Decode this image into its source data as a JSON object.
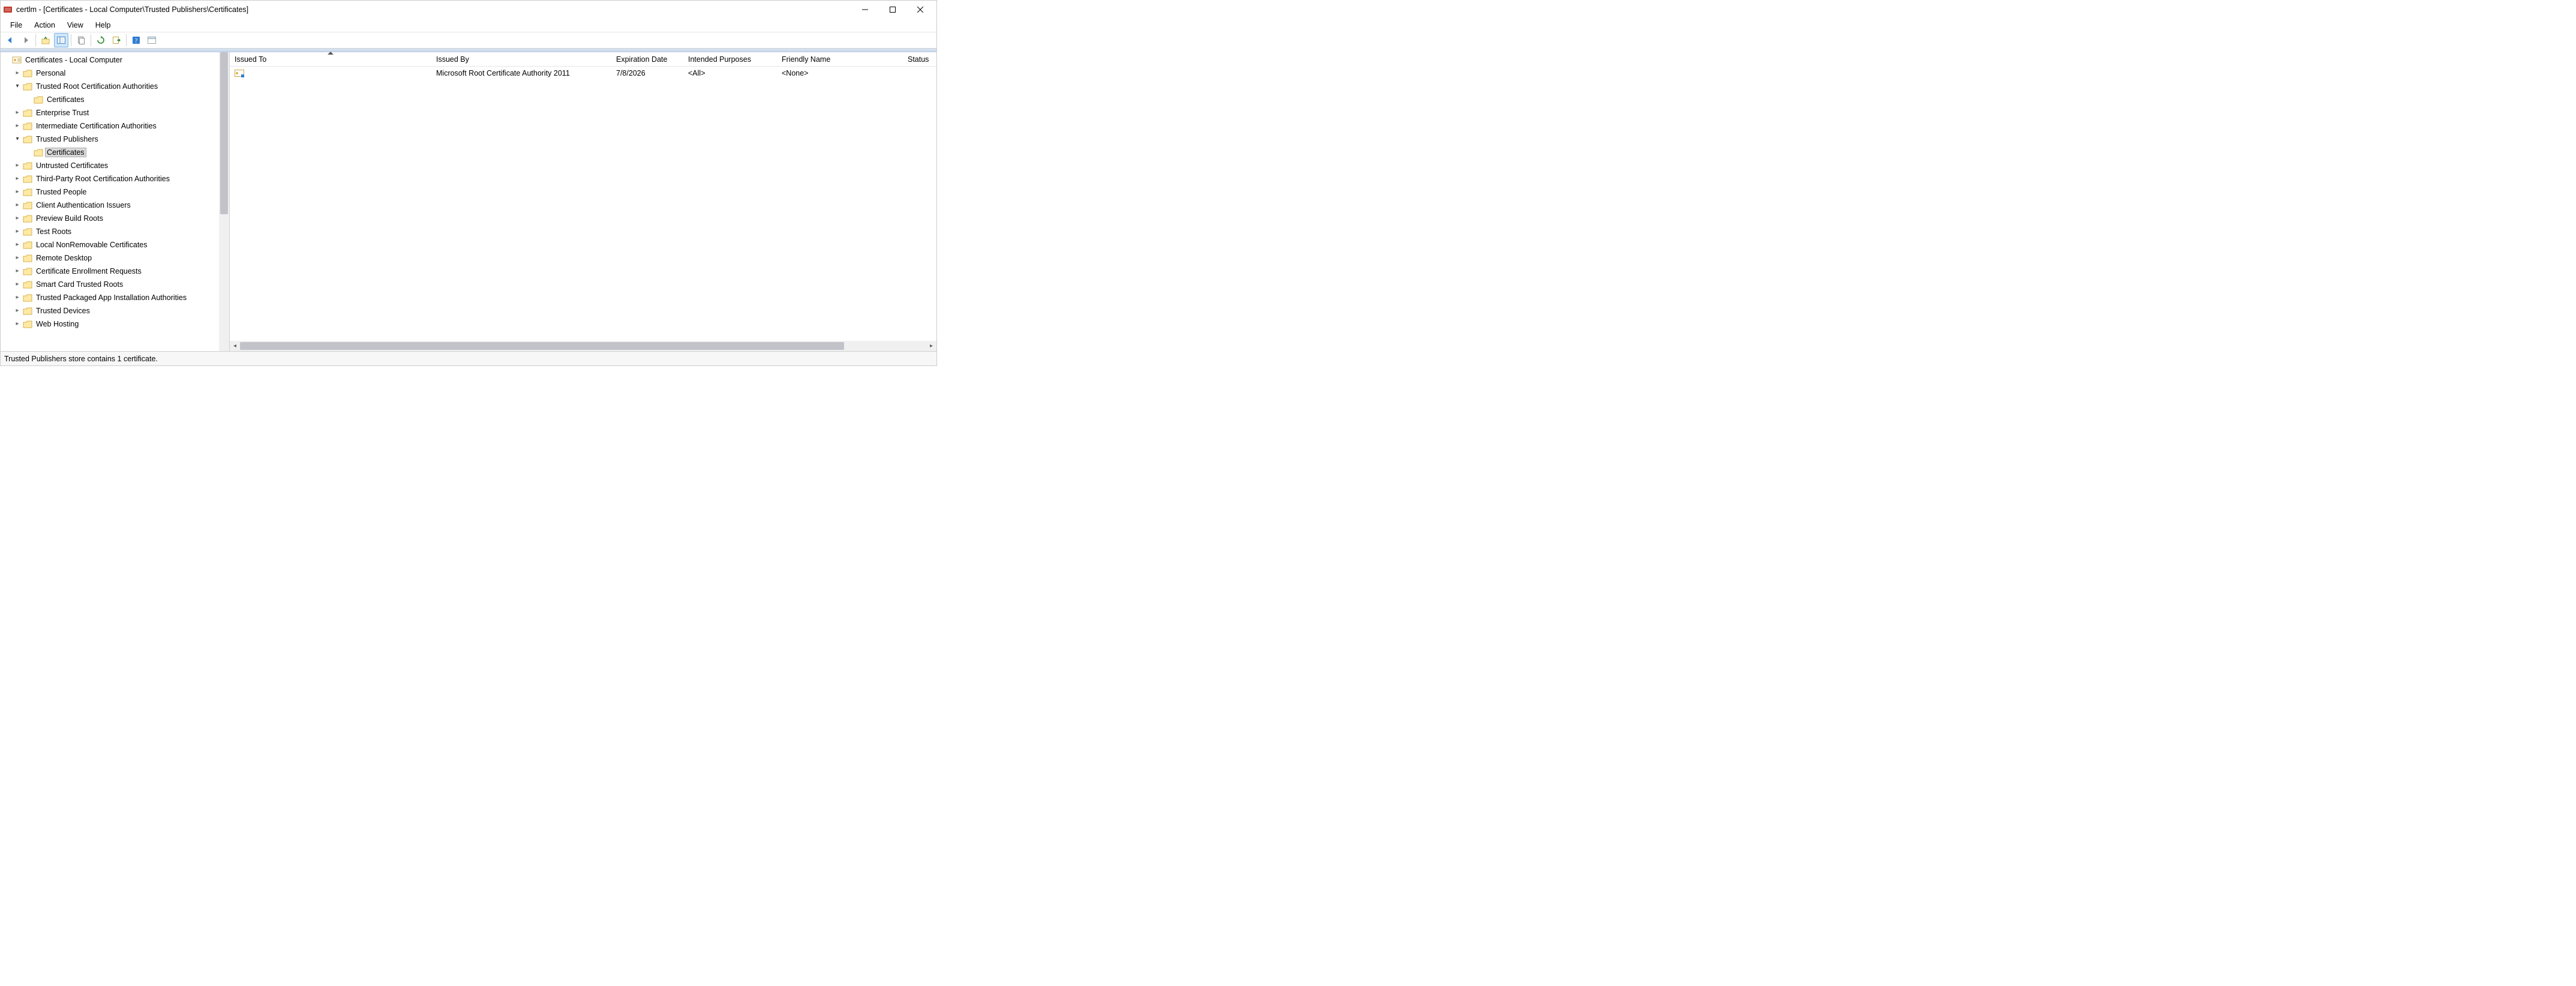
{
  "window": {
    "title": "certlm - [Certificates - Local Computer\\Trusted Publishers\\Certificates]"
  },
  "menu": {
    "file": "File",
    "action": "Action",
    "view": "View",
    "help": "Help"
  },
  "tree": {
    "root": "Certificates - Local Computer",
    "nodes": [
      {
        "label": "Personal",
        "expanded": false,
        "depth": 1
      },
      {
        "label": "Trusted Root Certification Authorities",
        "expanded": true,
        "depth": 1
      },
      {
        "label": "Certificates",
        "expanded": null,
        "depth": 2
      },
      {
        "label": "Enterprise Trust",
        "expanded": false,
        "depth": 1
      },
      {
        "label": "Intermediate Certification Authorities",
        "expanded": false,
        "depth": 1
      },
      {
        "label": "Trusted Publishers",
        "expanded": true,
        "depth": 1
      },
      {
        "label": "Certificates",
        "expanded": null,
        "depth": 2,
        "selected": true
      },
      {
        "label": "Untrusted Certificates",
        "expanded": false,
        "depth": 1
      },
      {
        "label": "Third-Party Root Certification Authorities",
        "expanded": false,
        "depth": 1
      },
      {
        "label": "Trusted People",
        "expanded": false,
        "depth": 1
      },
      {
        "label": "Client Authentication Issuers",
        "expanded": false,
        "depth": 1
      },
      {
        "label": "Preview Build Roots",
        "expanded": false,
        "depth": 1
      },
      {
        "label": "Test Roots",
        "expanded": false,
        "depth": 1
      },
      {
        "label": "Local NonRemovable Certificates",
        "expanded": false,
        "depth": 1
      },
      {
        "label": "Remote Desktop",
        "expanded": false,
        "depth": 1
      },
      {
        "label": "Certificate Enrollment Requests",
        "expanded": false,
        "depth": 1
      },
      {
        "label": "Smart Card Trusted Roots",
        "expanded": false,
        "depth": 1
      },
      {
        "label": "Trusted Packaged App Installation Authorities",
        "expanded": false,
        "depth": 1
      },
      {
        "label": "Trusted Devices",
        "expanded": false,
        "depth": 1
      },
      {
        "label": "Web Hosting",
        "expanded": false,
        "depth": 1
      }
    ]
  },
  "columns": {
    "issued_to": "Issued To",
    "issued_by": "Issued By",
    "expiration": "Expiration Date",
    "purposes": "Intended Purposes",
    "friendly": "Friendly Name",
    "status": "Status"
  },
  "rows": [
    {
      "issued_to": "",
      "issued_by": "Microsoft Root Certificate Authority 2011",
      "expiration": "7/8/2026",
      "purposes": "<All>",
      "friendly": "<None>",
      "status": ""
    }
  ],
  "status": {
    "text": "Trusted Publishers store contains 1 certificate."
  }
}
